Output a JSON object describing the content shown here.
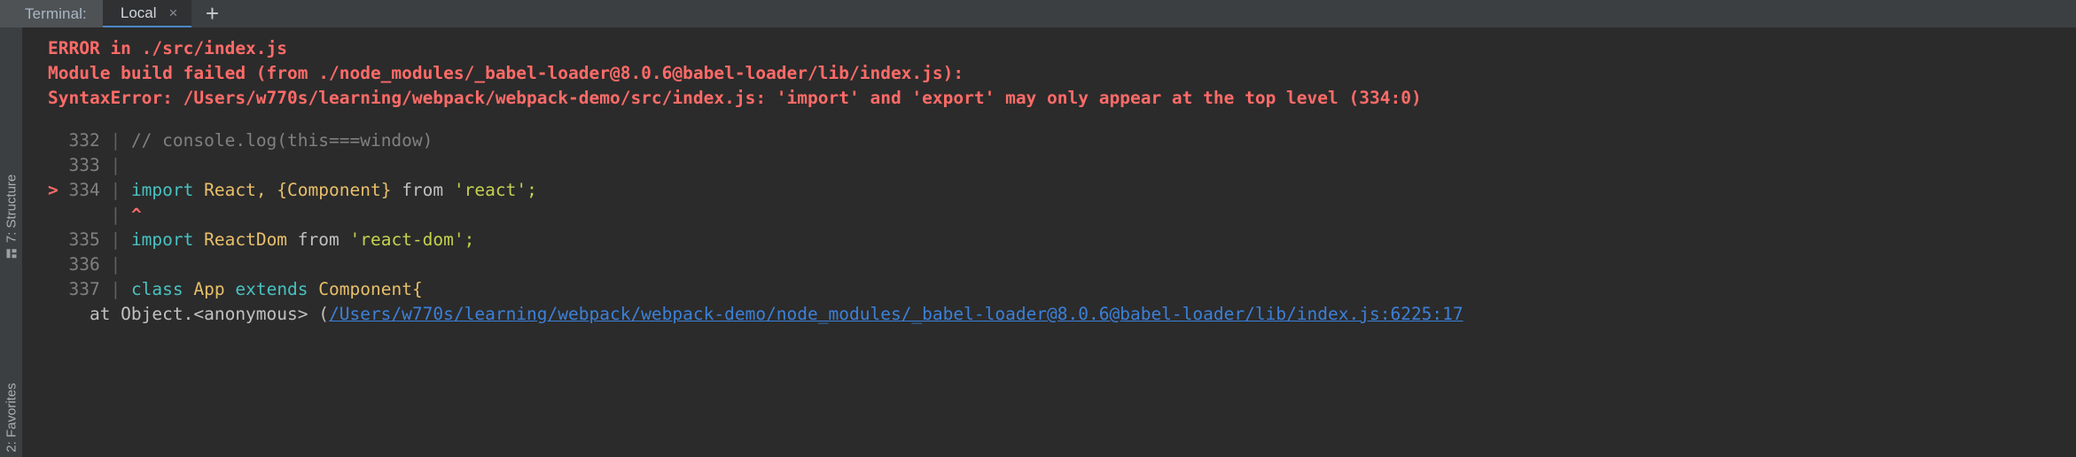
{
  "window": {
    "theme_bg": "#3c3f41",
    "console_bg": "#2b2b2b",
    "error_color": "#ff6b68",
    "accent_color": "#4a88c7"
  },
  "tabbar": {
    "label": "Terminal:",
    "tabs": [
      {
        "title": "Local",
        "close_icon": "×"
      }
    ],
    "add_tab_icon": "+"
  },
  "sidebar": {
    "items": [
      {
        "label": "7: Structure",
        "icon": "structure-icon"
      },
      {
        "label": "2: Favorites",
        "icon": "favorites-icon"
      }
    ]
  },
  "console": {
    "error_lines": [
      "ERROR in ./src/index.js",
      "Module build failed (from ./node_modules/_babel-loader@8.0.6@babel-loader/lib/index.js):",
      "SyntaxError: /Users/w770s/learning/webpack/webpack-demo/src/index.js: 'import' and 'export' may only appear at the top level (334:0)"
    ],
    "code_lines": [
      {
        "marker": "",
        "number": "332",
        "bar": "|",
        "tokens": [
          {
            "text": "// console.log(this===window)",
            "cls": "comment"
          }
        ]
      },
      {
        "marker": "",
        "number": "333",
        "bar": "|",
        "tokens": []
      },
      {
        "marker": ">",
        "number": "334",
        "bar": "|",
        "tokens": [
          {
            "text": "import ",
            "cls": "kw"
          },
          {
            "text": "React, {Component} ",
            "cls": "ident"
          },
          {
            "text": "from ",
            "cls": "plain"
          },
          {
            "text": "'react';",
            "cls": "str"
          }
        ]
      },
      {
        "marker": "",
        "number": "",
        "bar": "|",
        "tokens": [
          {
            "text": "^",
            "cls": "caret"
          }
        ]
      },
      {
        "marker": "",
        "number": "335",
        "bar": "|",
        "tokens": [
          {
            "text": "import ",
            "cls": "kw"
          },
          {
            "text": "ReactDom ",
            "cls": "ident"
          },
          {
            "text": "from ",
            "cls": "plain"
          },
          {
            "text": "'react-dom';",
            "cls": "str"
          }
        ]
      },
      {
        "marker": "",
        "number": "336",
        "bar": "|",
        "tokens": []
      },
      {
        "marker": "",
        "number": "337",
        "bar": "|",
        "tokens": [
          {
            "text": "class ",
            "cls": "kw"
          },
          {
            "text": "App ",
            "cls": "ident"
          },
          {
            "text": "extends ",
            "cls": "kw"
          },
          {
            "text": "Component{",
            "cls": "ident"
          }
        ]
      }
    ],
    "trailing_line": {
      "prefix": "    at Object.<anonymous> (",
      "link": "/Users/w770s/learning/webpack/webpack-demo/node_modules/_babel-loader@8.0.6@babel-loader/lib/index.js:6225:17"
    }
  }
}
